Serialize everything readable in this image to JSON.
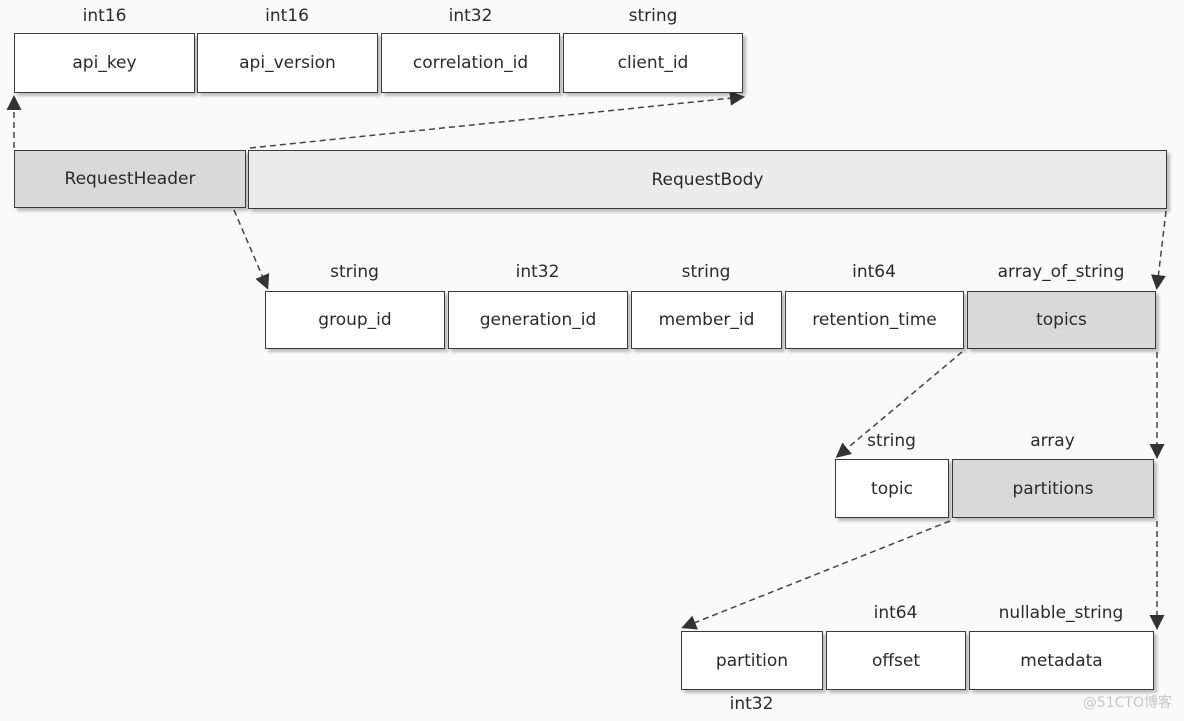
{
  "header_fields": [
    {
      "type": "int16",
      "name": "api_key"
    },
    {
      "type": "int16",
      "name": "api_version"
    },
    {
      "type": "int32",
      "name": "correlation_id"
    },
    {
      "type": "string",
      "name": "client_id"
    }
  ],
  "request": {
    "header": "RequestHeader",
    "body": "RequestBody"
  },
  "body_fields": [
    {
      "type": "string",
      "name": "group_id"
    },
    {
      "type": "int32",
      "name": "generation_id"
    },
    {
      "type": "string",
      "name": "member_id"
    },
    {
      "type": "int64",
      "name": "retention_time"
    },
    {
      "type": "array_of_string",
      "name": "topics"
    }
  ],
  "topic_fields": [
    {
      "type": "string",
      "name": "topic"
    },
    {
      "type": "array",
      "name": "partitions"
    }
  ],
  "partition_fields": [
    {
      "type": "int32",
      "name": "partition"
    },
    {
      "type": "int64",
      "name": "offset"
    },
    {
      "type": "nullable_string",
      "name": "metadata"
    }
  ],
  "watermark": "@51CTO博客"
}
